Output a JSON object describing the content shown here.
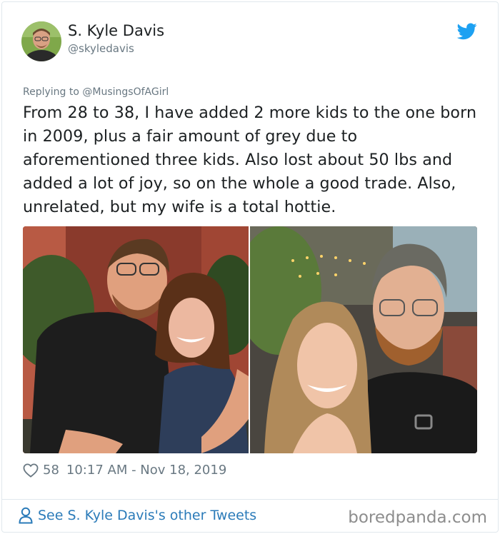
{
  "author": {
    "name": "S. Kyle Davis",
    "handle": "@skyledavis"
  },
  "reply": {
    "prefix": "Replying to ",
    "mention": "@MusingsOfAGirl"
  },
  "tweet": {
    "text": "From 28 to 38, I have added 2 more kids to the one born in 2009, plus a fair amount of grey due to aforementioned three kids. Also lost about 50 lbs and added a lot of joy, so on the whole a good trade. Also, unrelated, but my wife is a total hottie."
  },
  "meta": {
    "likes": "58",
    "timestamp": "10:17 AM - Nov 18, 2019"
  },
  "footer": {
    "link_label": "See S. Kyle Davis's other Tweets",
    "watermark": "boredpanda.com"
  },
  "icons": {
    "bird": "twitter-bird-icon",
    "heart": "heart-icon",
    "person": "person-icon"
  },
  "colors": {
    "link": "#2b7bb9",
    "twitter_blue": "#1da1f2",
    "secondary_text": "#697882"
  }
}
